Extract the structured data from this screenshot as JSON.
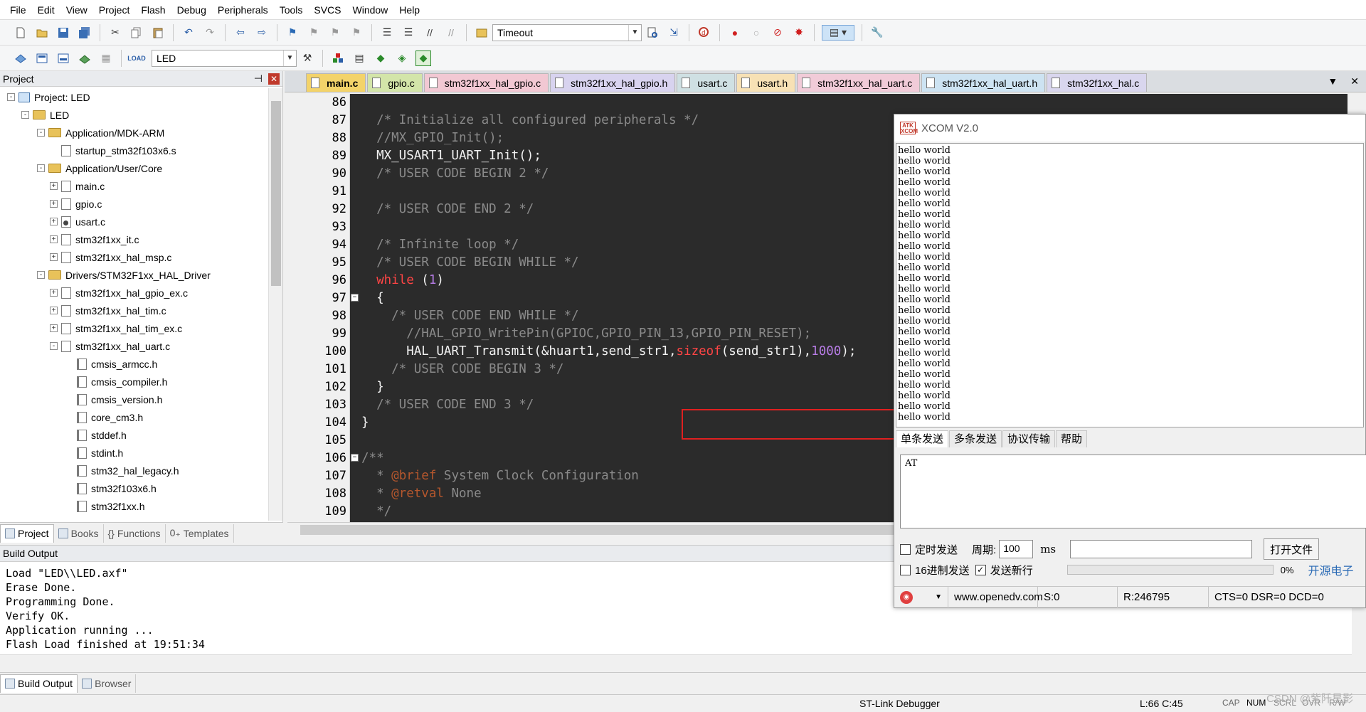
{
  "menu": [
    "File",
    "Edit",
    "View",
    "Project",
    "Flash",
    "Debug",
    "Peripherals",
    "Tools",
    "SVCS",
    "Window",
    "Help"
  ],
  "toolbar1": {
    "find_combo_value": "Timeout"
  },
  "toolbar2": {
    "target_combo_value": "LED"
  },
  "project_panel": {
    "title": "Project",
    "tree": [
      {
        "label": "Project: LED",
        "level": 0,
        "exp": "-",
        "icon": "project"
      },
      {
        "label": "LED",
        "level": 1,
        "exp": "-",
        "icon": "folder"
      },
      {
        "label": "Application/MDK-ARM",
        "level": 2,
        "exp": "-",
        "icon": "folder"
      },
      {
        "label": "startup_stm32f103x6.s",
        "level": 3,
        "exp": "",
        "icon": "file"
      },
      {
        "label": "Application/User/Core",
        "level": 2,
        "exp": "-",
        "icon": "folder"
      },
      {
        "label": "main.c",
        "level": 3,
        "exp": "+",
        "icon": "file"
      },
      {
        "label": "gpio.c",
        "level": 3,
        "exp": "+",
        "icon": "file"
      },
      {
        "label": "usart.c",
        "level": 3,
        "exp": "+",
        "icon": "gear"
      },
      {
        "label": "stm32f1xx_it.c",
        "level": 3,
        "exp": "+",
        "icon": "file"
      },
      {
        "label": "stm32f1xx_hal_msp.c",
        "level": 3,
        "exp": "+",
        "icon": "file"
      },
      {
        "label": "Drivers/STM32F1xx_HAL_Driver",
        "level": 2,
        "exp": "-",
        "icon": "folder"
      },
      {
        "label": "stm32f1xx_hal_gpio_ex.c",
        "level": 3,
        "exp": "+",
        "icon": "file"
      },
      {
        "label": "stm32f1xx_hal_tim.c",
        "level": 3,
        "exp": "+",
        "icon": "file"
      },
      {
        "label": "stm32f1xx_hal_tim_ex.c",
        "level": 3,
        "exp": "+",
        "icon": "file"
      },
      {
        "label": "stm32f1xx_hal_uart.c",
        "level": 3,
        "exp": "-",
        "icon": "file"
      },
      {
        "label": "cmsis_armcc.h",
        "level": 4,
        "exp": "",
        "icon": "header"
      },
      {
        "label": "cmsis_compiler.h",
        "level": 4,
        "exp": "",
        "icon": "header"
      },
      {
        "label": "cmsis_version.h",
        "level": 4,
        "exp": "",
        "icon": "header"
      },
      {
        "label": "core_cm3.h",
        "level": 4,
        "exp": "",
        "icon": "header"
      },
      {
        "label": "stddef.h",
        "level": 4,
        "exp": "",
        "icon": "header"
      },
      {
        "label": "stdint.h",
        "level": 4,
        "exp": "",
        "icon": "header"
      },
      {
        "label": "stm32_hal_legacy.h",
        "level": 4,
        "exp": "",
        "icon": "header"
      },
      {
        "label": "stm32f103x6.h",
        "level": 4,
        "exp": "",
        "icon": "header"
      },
      {
        "label": "stm32f1xx.h",
        "level": 4,
        "exp": "",
        "icon": "header"
      }
    ],
    "tabs": [
      "Project",
      "Books",
      "Functions",
      "Templates"
    ]
  },
  "editor": {
    "tabs": [
      "main.c",
      "gpio.c",
      "stm32f1xx_hal_gpio.c",
      "stm32f1xx_hal_gpio.h",
      "usart.c",
      "usart.h",
      "stm32f1xx_hal_uart.c",
      "stm32f1xx_hal_uart.h",
      "stm32f1xx_hal.c"
    ],
    "line_numbers": [
      "86",
      "87",
      "88",
      "89",
      "90",
      "91",
      "92",
      "93",
      "94",
      "95",
      "96",
      "97",
      "98",
      "99",
      "100",
      "101",
      "102",
      "103",
      "104",
      "105",
      "106",
      "107",
      "108",
      "109"
    ],
    "code": [
      "",
      "  /* Initialize all configured peripherals */",
      "  //MX_GPIO_Init();",
      "  MX_USART1_UART_Init();",
      "  /* USER CODE BEGIN 2 */",
      "",
      "  /* USER CODE END 2 */",
      "",
      "  /* Infinite loop */",
      "  /* USER CODE BEGIN WHILE */",
      "  while (1)",
      "  {",
      "    /* USER CODE END WHILE */",
      "      //HAL_GPIO_WritePin(GPIOC,GPIO_PIN_13,GPIO_PIN_RESET);",
      "      HAL_UART_Transmit(&huart1,send_str1,sizeof(send_str1),1000);",
      "    /* USER CODE BEGIN 3 */",
      "  }",
      "  /* USER CODE END 3 */",
      "}",
      "",
      "/**",
      "  * @brief System Clock Configuration",
      "  * @retval None",
      "  */"
    ]
  },
  "xcom": {
    "title": "XCOM V2.0",
    "logo_text": "ATK XCOM",
    "recv_lines": [
      "hello world",
      "hello world",
      "hello world",
      "hello world",
      "hello world",
      "hello world",
      "hello world",
      "hello world",
      "hello world",
      "hello world",
      "hello world",
      "hello world",
      "hello world",
      "hello world",
      "hello world",
      "hello world",
      "hello world",
      "hello world",
      "hello world",
      "hello world",
      "hello world",
      "hello world",
      "hello world",
      "hello world",
      "hello world",
      "hello world"
    ],
    "tabs": [
      "单条发送",
      "多条发送",
      "协议传输",
      "帮助"
    ],
    "send_text": "AT",
    "timed_send_label": "定时发送",
    "period_label": "周期:",
    "period_value": "100",
    "period_unit": "ms",
    "open_file_button": "打开文件",
    "hex_send_label": "16进制发送",
    "newline_label": "发送新行",
    "progress_text": "0%",
    "brand_link": "开源电子",
    "status": {
      "url": "www.openedv.com",
      "sent": "S:0",
      "received": "R:246795",
      "signals": "CTS=0 DSR=0 DCD=0"
    }
  },
  "build_output": {
    "title": "Build Output",
    "lines": [
      "Load \"LED\\\\LED.axf\"",
      "Erase Done.",
      "Programming Done.",
      "Verify OK.",
      "Application running ...",
      "Flash Load finished at 19:51:34"
    ],
    "tabs": [
      "Build Output",
      "Browser"
    ]
  },
  "statusbar": {
    "debugger": "ST-Link Debugger",
    "position": "L:66 C:45",
    "cap": "CAP",
    "num": "NUM",
    "scrl": "SCRL",
    "ovr": "OVR",
    "rw": "R/W"
  },
  "watermark": "CSDN @紫阡星影"
}
